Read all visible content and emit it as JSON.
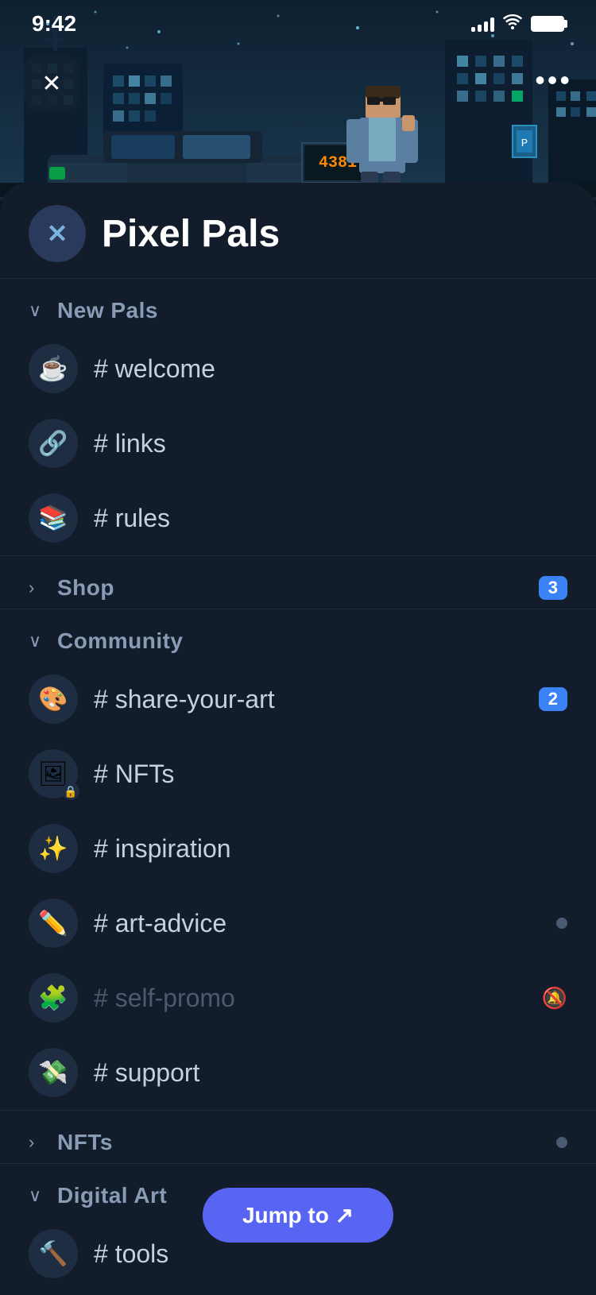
{
  "status": {
    "time": "9:42"
  },
  "hero": {
    "close_label": "×",
    "more_label": "···"
  },
  "server": {
    "icon_text": "✕",
    "name": "Pixel Pals"
  },
  "categories": [
    {
      "id": "new-pals",
      "name": "New Pals",
      "expanded": true,
      "badge": null,
      "channels": [
        {
          "id": "welcome",
          "emoji": "☕",
          "name": "# welcome",
          "badge": null,
          "muted": false,
          "locked": false,
          "dot": false,
          "bell_off": false
        },
        {
          "id": "links",
          "emoji": "🔗",
          "name": "# links",
          "badge": null,
          "muted": false,
          "locked": false,
          "dot": false,
          "bell_off": false
        },
        {
          "id": "rules",
          "emoji": "📚",
          "name": "# rules",
          "badge": null,
          "muted": false,
          "locked": false,
          "dot": false,
          "bell_off": false
        }
      ]
    },
    {
      "id": "shop",
      "name": "Shop",
      "expanded": false,
      "badge": "3",
      "channels": []
    },
    {
      "id": "community",
      "name": "Community",
      "expanded": true,
      "badge": null,
      "channels": [
        {
          "id": "share-your-art",
          "emoji": "🎨",
          "name": "# share-your-art",
          "badge": "2",
          "muted": false,
          "locked": false,
          "dot": false,
          "bell_off": false
        },
        {
          "id": "nfts",
          "emoji": "🖼️",
          "name": "# NFTs",
          "badge": null,
          "muted": false,
          "locked": true,
          "dot": false,
          "bell_off": false
        },
        {
          "id": "inspiration",
          "emoji": "✨",
          "name": "# inspiration",
          "badge": null,
          "muted": false,
          "locked": false,
          "dot": false,
          "bell_off": false
        },
        {
          "id": "art-advice",
          "emoji": "✏️",
          "name": "# art-advice",
          "badge": null,
          "muted": false,
          "locked": false,
          "dot": true,
          "bell_off": false
        },
        {
          "id": "self-promo",
          "emoji": "🧩",
          "name": "# self-promo",
          "badge": null,
          "muted": true,
          "locked": false,
          "dot": false,
          "bell_off": true
        },
        {
          "id": "support",
          "emoji": "💸",
          "name": "# support",
          "badge": null,
          "muted": false,
          "locked": false,
          "dot": false,
          "bell_off": false
        }
      ]
    },
    {
      "id": "nfts-cat",
      "name": "NFTs",
      "expanded": false,
      "badge": null,
      "dot": true,
      "channels": []
    },
    {
      "id": "digital-art",
      "name": "Digital Art",
      "expanded": true,
      "badge": null,
      "channels": [
        {
          "id": "tools",
          "emoji": "🔨",
          "name": "# tools",
          "badge": null,
          "muted": false,
          "locked": false,
          "dot": false,
          "bell_off": false
        }
      ]
    }
  ],
  "jump_to": {
    "label": "Jump to ↗"
  }
}
